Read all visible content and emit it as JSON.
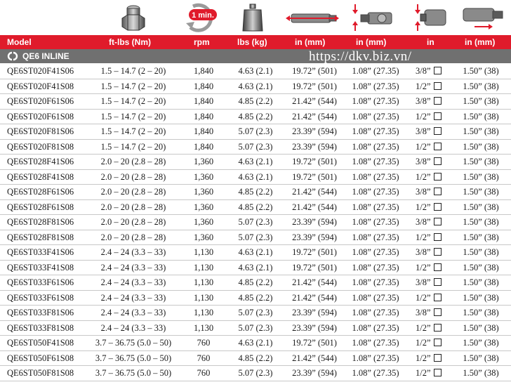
{
  "icons": [
    "nut-icon",
    "timer-1-min-icon",
    "weight-icon",
    "length-icon",
    "offset-icon",
    "square-drive-icon",
    "diameter-icon"
  ],
  "timer_label": "1 min.",
  "colors": {
    "header": "#e01b2b",
    "section": "#707070"
  },
  "header": {
    "model": "Model",
    "torque": "ft-lbs (Nm)",
    "rpm": "rpm",
    "weight": "lbs (kg)",
    "length": "in (mm)",
    "offset": "in (mm)",
    "drive": "in",
    "diameter": "in (mm)"
  },
  "section": {
    "title": "QE6 INLINE"
  },
  "watermark": "https://dkv.biz.vn/",
  "rows": [
    {
      "model": "QE6ST020F41S06",
      "torque": "1.5 – 14.7 (2 – 20)",
      "rpm": "1,840",
      "weight": "4.63 (2.1)",
      "length": "19.72” (501)",
      "offset": "1.08” (27.35)",
      "drive": "3/8”",
      "diameter": "1.50” (38)"
    },
    {
      "model": "QE6ST020F41S08",
      "torque": "1.5 – 14.7 (2 – 20)",
      "rpm": "1,840",
      "weight": "4.63 (2.1)",
      "length": "19.72” (501)",
      "offset": "1.08” (27.35)",
      "drive": "1/2”",
      "diameter": "1.50” (38)"
    },
    {
      "model": "QE6ST020F61S06",
      "torque": "1.5 – 14.7 (2 – 20)",
      "rpm": "1,840",
      "weight": "4.85 (2.2)",
      "length": "21.42” (544)",
      "offset": "1.08” (27.35)",
      "drive": "3/8”",
      "diameter": "1.50” (38)"
    },
    {
      "model": "QE6ST020F61S08",
      "torque": "1.5 – 14.7 (2 – 20)",
      "rpm": "1,840",
      "weight": "4.85 (2.2)",
      "length": "21.42” (544)",
      "offset": "1.08” (27.35)",
      "drive": "1/2”",
      "diameter": "1.50” (38)"
    },
    {
      "model": "QE6ST020F81S06",
      "torque": "1.5 – 14.7 (2 – 20)",
      "rpm": "1,840",
      "weight": "5.07 (2.3)",
      "length": "23.39” (594)",
      "offset": "1.08” (27.35)",
      "drive": "3/8”",
      "diameter": "1.50” (38)"
    },
    {
      "model": "QE6ST020F81S08",
      "torque": "1.5 – 14.7 (2 – 20)",
      "rpm": "1,840",
      "weight": "5.07 (2.3)",
      "length": "23.39” (594)",
      "offset": "1.08” (27.35)",
      "drive": "1/2”",
      "diameter": "1.50” (38)"
    },
    {
      "model": "QE6ST028F41S06",
      "torque": "2.0 – 20 (2.8 – 28)",
      "rpm": "1,360",
      "weight": "4.63 (2.1)",
      "length": "19.72” (501)",
      "offset": "1.08” (27.35)",
      "drive": "3/8”",
      "diameter": "1.50” (38)"
    },
    {
      "model": "QE6ST028F41S08",
      "torque": "2.0 – 20 (2.8 – 28)",
      "rpm": "1,360",
      "weight": "4.63 (2.1)",
      "length": "19.72” (501)",
      "offset": "1.08” (27.35)",
      "drive": "1/2”",
      "diameter": "1.50” (38)"
    },
    {
      "model": "QE6ST028F61S06",
      "torque": "2.0 – 20 (2.8 – 28)",
      "rpm": "1,360",
      "weight": "4.85 (2.2)",
      "length": "21.42” (544)",
      "offset": "1.08” (27.35)",
      "drive": "3/8”",
      "diameter": "1.50” (38)"
    },
    {
      "model": "QE6ST028F61S08",
      "torque": "2.0 – 20 (2.8 – 28)",
      "rpm": "1,360",
      "weight": "4.85 (2.2)",
      "length": "21.42” (544)",
      "offset": "1.08” (27.35)",
      "drive": "1/2”",
      "diameter": "1.50” (38)"
    },
    {
      "model": "QE6ST028F81S06",
      "torque": "2.0 – 20 (2.8 – 28)",
      "rpm": "1,360",
      "weight": "5.07 (2.3)",
      "length": "23.39” (594)",
      "offset": "1.08” (27.35)",
      "drive": "3/8”",
      "diameter": "1.50” (38)"
    },
    {
      "model": "QE6ST028F81S08",
      "torque": "2.0 – 20 (2.8 – 28)",
      "rpm": "1,360",
      "weight": "5.07 (2.3)",
      "length": "23.39” (594)",
      "offset": "1.08” (27.35)",
      "drive": "1/2”",
      "diameter": "1.50” (38)"
    },
    {
      "model": "QE6ST033F41S06",
      "torque": "2.4 – 24 (3.3 – 33)",
      "rpm": "1,130",
      "weight": "4.63 (2.1)",
      "length": "19.72” (501)",
      "offset": "1.08” (27.35)",
      "drive": "3/8”",
      "diameter": "1.50” (38)"
    },
    {
      "model": "QE6ST033F41S08",
      "torque": "2.4 – 24 (3.3 – 33)",
      "rpm": "1,130",
      "weight": "4.63 (2.1)",
      "length": "19.72” (501)",
      "offset": "1.08” (27.35)",
      "drive": "1/2”",
      "diameter": "1.50” (38)"
    },
    {
      "model": "QE6ST033F61S06",
      "torque": "2.4 – 24 (3.3 – 33)",
      "rpm": "1,130",
      "weight": "4.85 (2.2)",
      "length": "21.42” (544)",
      "offset": "1.08” (27.35)",
      "drive": "3/8”",
      "diameter": "1.50” (38)"
    },
    {
      "model": "QE6ST033F61S08",
      "torque": "2.4 – 24 (3.3 – 33)",
      "rpm": "1,130",
      "weight": "4.85 (2.2)",
      "length": "21.42” (544)",
      "offset": "1.08” (27.35)",
      "drive": "1/2”",
      "diameter": "1.50” (38)"
    },
    {
      "model": "QE6ST033F81S06",
      "torque": "2.4 – 24 (3.3 – 33)",
      "rpm": "1,130",
      "weight": "5.07 (2.3)",
      "length": "23.39” (594)",
      "offset": "1.08” (27.35)",
      "drive": "3/8”",
      "diameter": "1.50” (38)"
    },
    {
      "model": "QE6ST033F81S08",
      "torque": "2.4 – 24 (3.3 – 33)",
      "rpm": "1,130",
      "weight": "5.07 (2.3)",
      "length": "23.39” (594)",
      "offset": "1.08” (27.35)",
      "drive": "1/2”",
      "diameter": "1.50” (38)"
    },
    {
      "model": "QE6ST050F41S08",
      "torque": "3.7 – 36.75 (5.0 – 50)",
      "rpm": "760",
      "weight": "4.63 (2.1)",
      "length": "19.72” (501)",
      "offset": "1.08” (27.35)",
      "drive": "1/2”",
      "diameter": "1.50” (38)"
    },
    {
      "model": "QE6ST050F61S08",
      "torque": "3.7 – 36.75 (5.0 – 50)",
      "rpm": "760",
      "weight": "4.85 (2.2)",
      "length": "21.42” (544)",
      "offset": "1.08” (27.35)",
      "drive": "1/2”",
      "diameter": "1.50” (38)"
    },
    {
      "model": "QE6ST050F81S08",
      "torque": "3.7 – 36.75 (5.0 – 50)",
      "rpm": "760",
      "weight": "5.07 (2.3)",
      "length": "23.39” (594)",
      "offset": "1.08” (27.35)",
      "drive": "1/2”",
      "diameter": "1.50” (38)"
    }
  ]
}
